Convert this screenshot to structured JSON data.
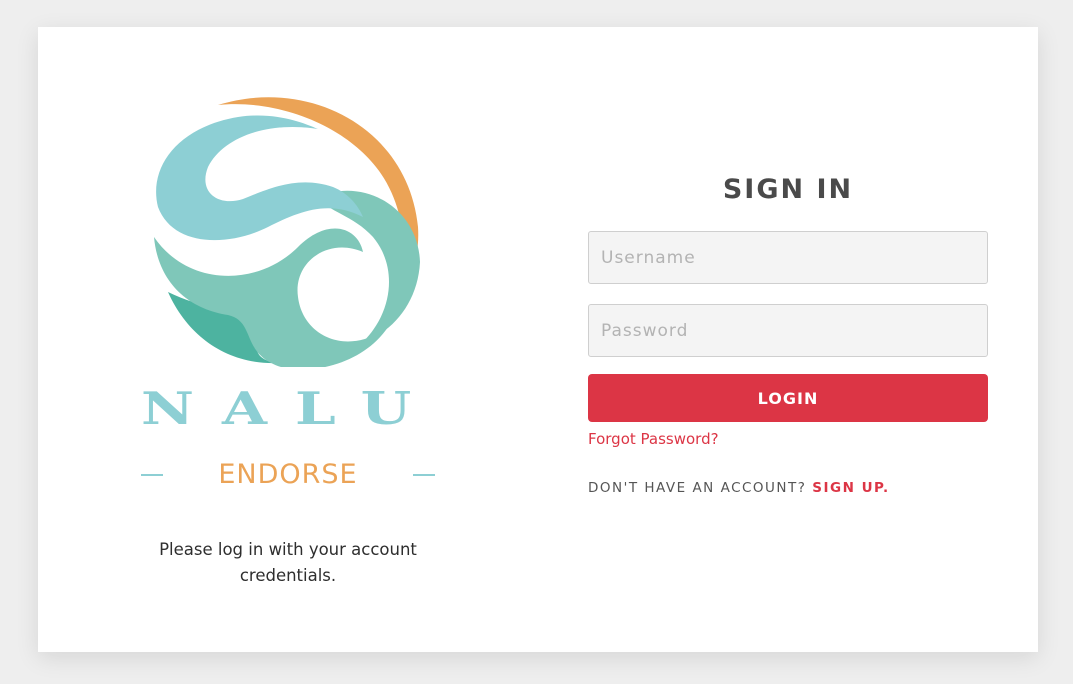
{
  "brand": {
    "wordmark": "NALU",
    "submark": "ENDORSE",
    "colors": {
      "teal_light": "#8dcfd4",
      "teal_mid": "#7fc7b9",
      "teal_dark": "#4db3a0",
      "orange": "#eba356"
    },
    "icon": "wave-logo-icon"
  },
  "left_panel": {
    "note": "Please log in with your account credentials."
  },
  "signin": {
    "title": "SIGN IN",
    "username_placeholder": "Username",
    "password_placeholder": "Password",
    "login_label": "LOGIN",
    "forgot_label": "Forgot Password?",
    "no_account_text": "DON'T HAVE AN ACCOUNT?",
    "signup_label": "SIGN UP.",
    "accent_color": "#dc3545"
  }
}
